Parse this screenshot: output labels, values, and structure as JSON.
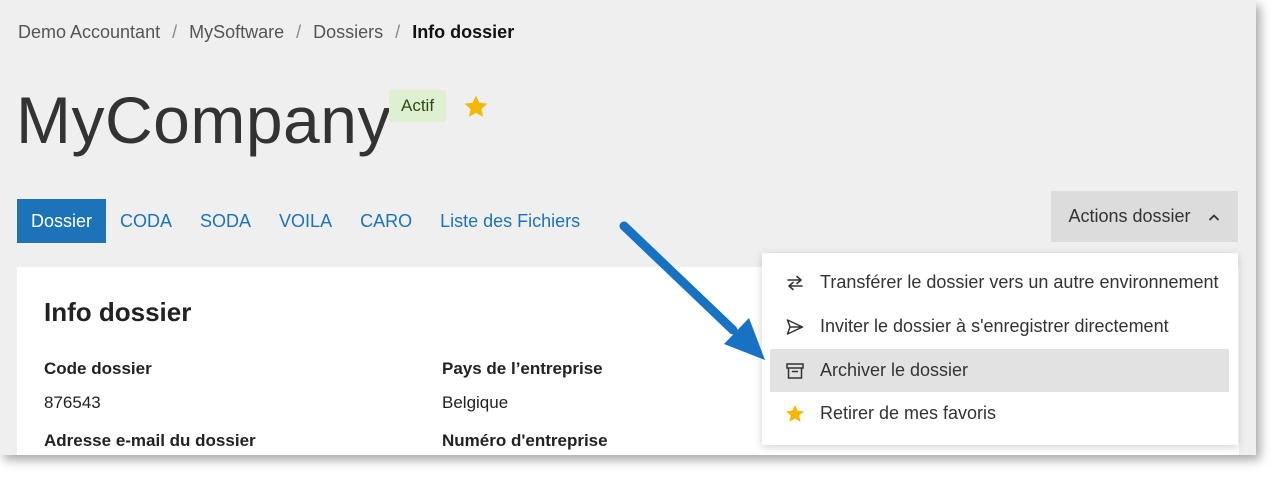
{
  "breadcrumb": {
    "items": [
      "Demo Accountant",
      "MySoftware",
      "Dossiers"
    ],
    "separator": "/",
    "current": "Info dossier"
  },
  "header": {
    "title": "MyCompany",
    "status_badge": "Actif",
    "favorite_icon": "star-icon"
  },
  "tabs": [
    {
      "label": "Dossier",
      "active": true
    },
    {
      "label": "CODA",
      "active": false
    },
    {
      "label": "SODA",
      "active": false
    },
    {
      "label": "VOILA",
      "active": false
    },
    {
      "label": "CARO",
      "active": false
    },
    {
      "label": "Liste des Fichiers",
      "active": false
    }
  ],
  "actions": {
    "label": "Actions dossier",
    "icon": "chevron-up-icon",
    "menu": [
      {
        "label": "Transférer le dossier vers un autre environnement",
        "icon": "transfer-icon"
      },
      {
        "label": "Inviter le dossier à s'enregistrer directement",
        "icon": "send-icon"
      },
      {
        "label": "Archiver le dossier",
        "icon": "archive-icon",
        "highlighted": true
      },
      {
        "label": "Retirer de mes favoris",
        "icon": "star-icon"
      }
    ]
  },
  "info": {
    "title": "Info dossier",
    "fields": {
      "code_label": "Code dossier",
      "code_value": "876543",
      "email_label": "Adresse e-mail du dossier",
      "country_label": "Pays de l’entreprise",
      "country_value": "Belgique",
      "company_number_label": "Numéro d'entreprise"
    }
  },
  "colors": {
    "accent": "#1c73b8",
    "badge_bg": "#dff0d0",
    "star": "#f5b800",
    "annotation_arrow": "#1872c4"
  }
}
